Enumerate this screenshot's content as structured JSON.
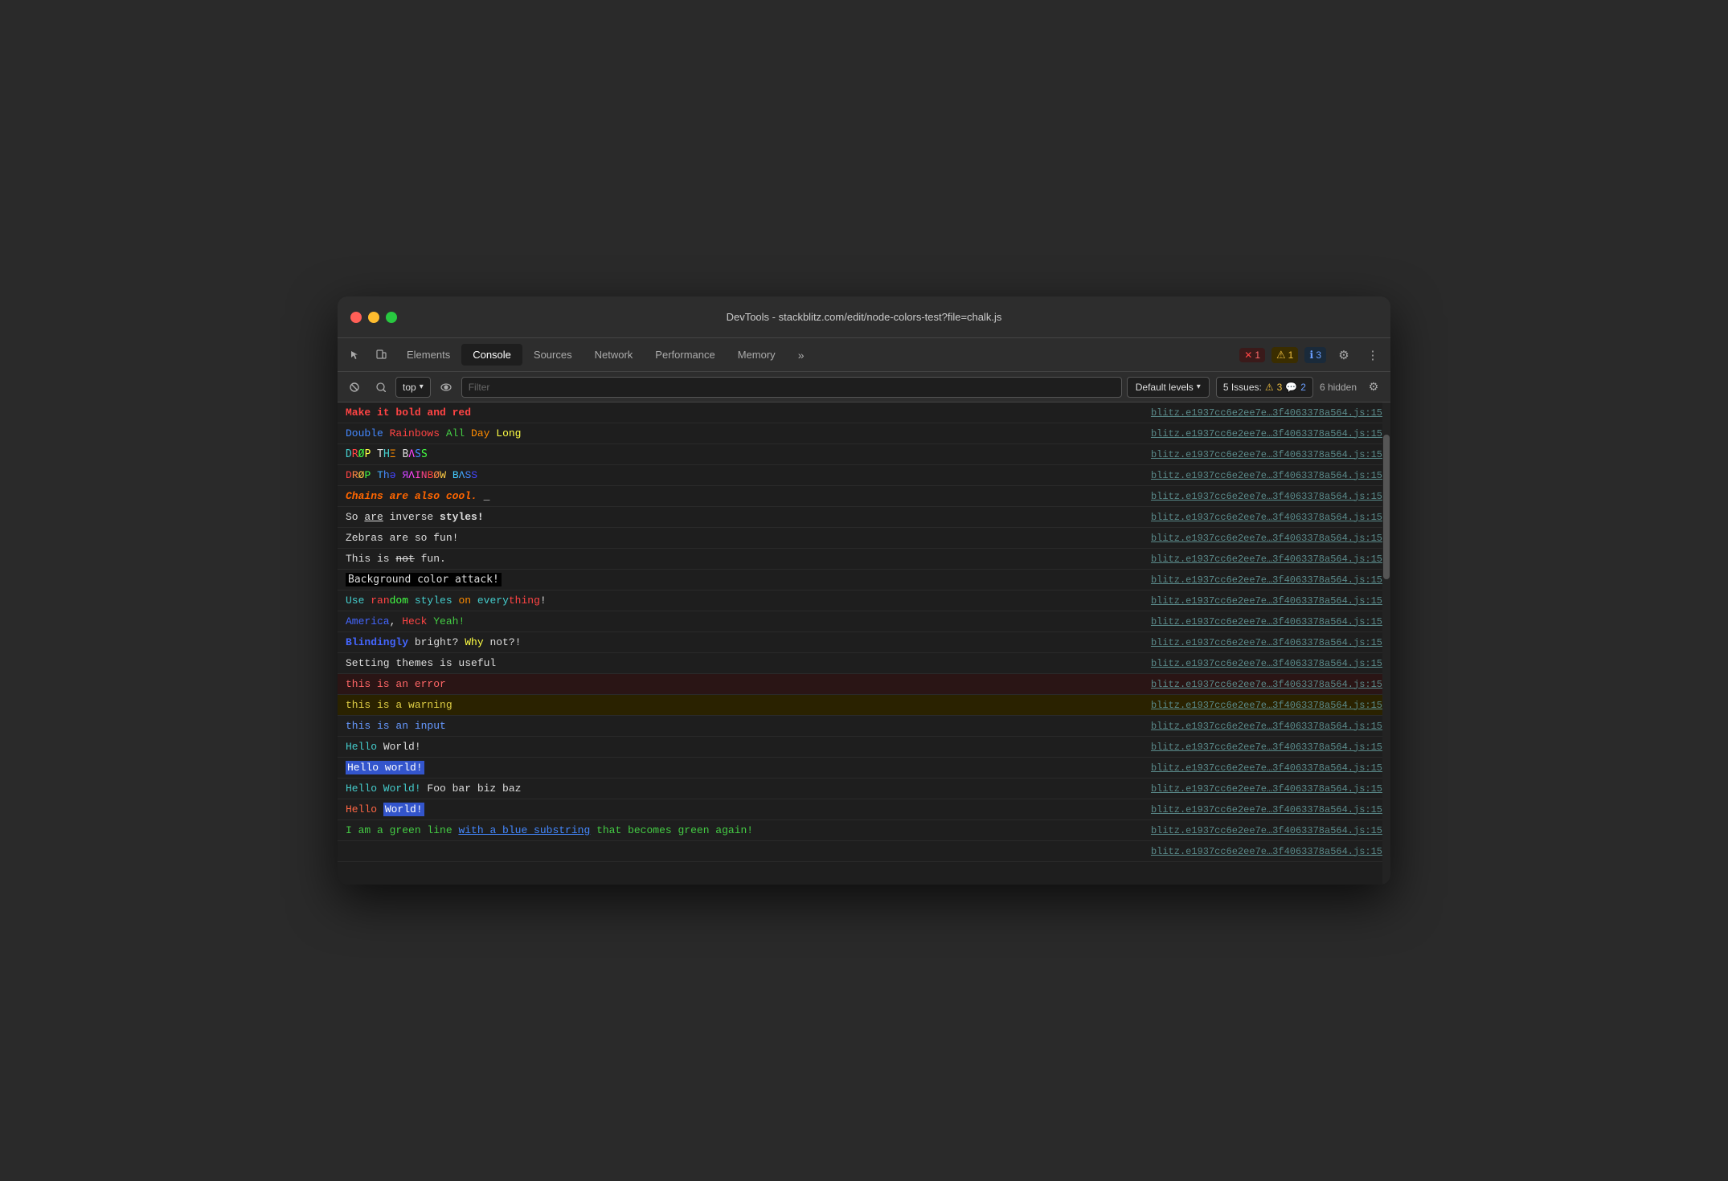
{
  "window": {
    "title": "DevTools - stackblitz.com/edit/node-colors-test?file=chalk.js",
    "tabs": [
      {
        "id": "elements",
        "label": "Elements",
        "active": false
      },
      {
        "id": "console",
        "label": "Console",
        "active": true
      },
      {
        "id": "sources",
        "label": "Sources",
        "active": false
      },
      {
        "id": "network",
        "label": "Network",
        "active": false
      },
      {
        "id": "performance",
        "label": "Performance",
        "active": false
      },
      {
        "id": "memory",
        "label": "Memory",
        "active": false
      }
    ],
    "badges": {
      "red": {
        "icon": "✕",
        "count": "1"
      },
      "yellow": {
        "icon": "⚠",
        "count": "1"
      },
      "blue": {
        "icon": "ℹ",
        "count": "3"
      }
    }
  },
  "toolbar": {
    "top_dropdown": "top",
    "filter_placeholder": "Filter",
    "levels_label": "Default levels",
    "issues_label": "5 Issues:",
    "issues_warn": "3",
    "issues_info": "2",
    "hidden_label": "6 hidden"
  },
  "source_link": "blitz.e1937cc6e2ee7e…3f4063378a564.js:15",
  "console_rows": [
    {
      "id": 1,
      "type": "styled"
    },
    {
      "id": 2,
      "type": "styled"
    },
    {
      "id": 3,
      "type": "styled"
    },
    {
      "id": 4,
      "type": "styled"
    },
    {
      "id": 5,
      "type": "styled"
    },
    {
      "id": 6,
      "type": "styled"
    },
    {
      "id": 7,
      "type": "styled"
    },
    {
      "id": 8,
      "type": "styled"
    },
    {
      "id": 9,
      "type": "styled"
    },
    {
      "id": 10,
      "type": "styled"
    },
    {
      "id": 11,
      "type": "styled"
    },
    {
      "id": 12,
      "type": "styled"
    },
    {
      "id": 13,
      "type": "styled"
    },
    {
      "id": 14,
      "type": "error"
    },
    {
      "id": 15,
      "type": "warning"
    },
    {
      "id": 16,
      "type": "input"
    },
    {
      "id": 17,
      "type": "styled"
    },
    {
      "id": 18,
      "type": "styled"
    },
    {
      "id": 19,
      "type": "styled"
    },
    {
      "id": 20,
      "type": "styled"
    },
    {
      "id": 21,
      "type": "styled"
    },
    {
      "id": 22,
      "type": "styled"
    }
  ]
}
